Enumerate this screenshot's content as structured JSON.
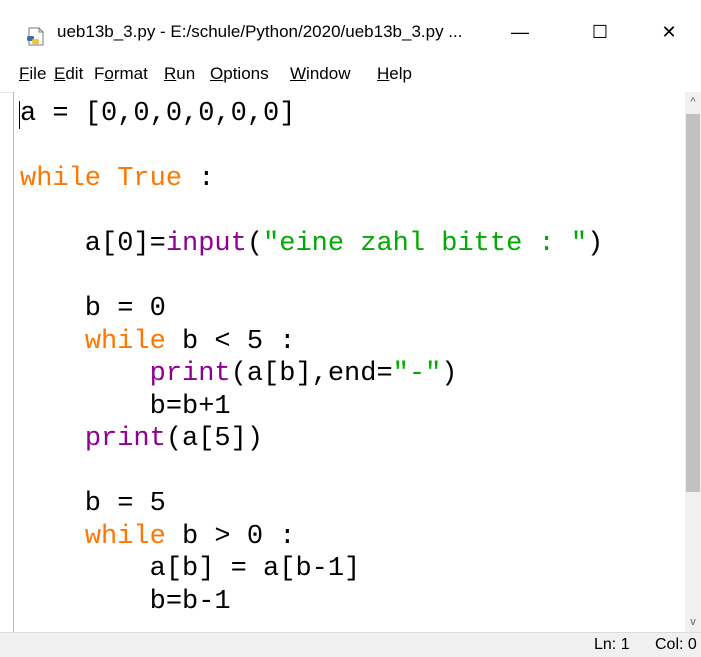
{
  "window": {
    "title": "ueb13b_3.py - E:/schule/Python/2020/ueb13b_3.py ...",
    "app_icon": "python-file-icon",
    "minimize_glyph": "—",
    "maximize_glyph": "☐",
    "close_glyph": "✕"
  },
  "menu": {
    "items": [
      {
        "label": "File",
        "underline": "F",
        "rest": "ile"
      },
      {
        "label": "Edit",
        "underline": "E",
        "rest": "dit"
      },
      {
        "label": "Format",
        "underline": "F",
        "prefix": "F",
        "rest": "ormat"
      },
      {
        "label": "Run",
        "underline": "R",
        "rest": "un"
      },
      {
        "label": "Options",
        "underline": "O",
        "rest": "ptions"
      },
      {
        "label": "Window",
        "underline": "W",
        "rest": "indow"
      },
      {
        "label": "Help",
        "underline": "H",
        "rest": "elp"
      }
    ]
  },
  "editor": {
    "lines": [
      "a = [0,0,0,0,0,0]",
      "",
      "while True :",
      "",
      "    a[0]=input(\"eine zahl bitte : \")",
      "",
      "    b = 0",
      "    while b < 5 :",
      "        print(a[b],end=\"-\")",
      "        b=b+1",
      "    print(a[5])",
      "",
      "    b = 5",
      "    while b > 0 :",
      "        a[b] = a[b-1]",
      "        b=b-1"
    ],
    "syntax_colors": {
      "keyword": "#ff7700",
      "builtin": "#900090",
      "string": "#00aa00",
      "default": "#000000"
    }
  },
  "scrollbar": {
    "up_glyph": "^",
    "down_glyph": "v"
  },
  "status": {
    "line": "Ln: 1",
    "col": "Col: 0"
  }
}
